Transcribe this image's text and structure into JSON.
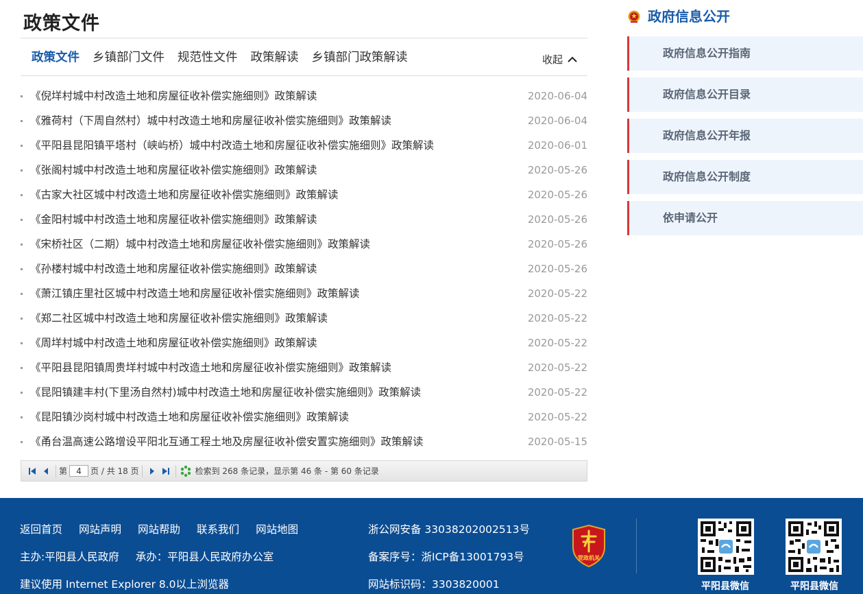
{
  "main": {
    "title": "政策文件",
    "tabs": [
      {
        "label": "政策文件",
        "active": true
      },
      {
        "label": "乡镇部门文件",
        "active": false
      },
      {
        "label": "规范性文件",
        "active": false
      },
      {
        "label": "政策解读",
        "active": false
      },
      {
        "label": "乡镇部门政策解读",
        "active": false
      }
    ],
    "collapse_label": "收起",
    "items": [
      {
        "title": "《倪垟村城中村改造土地和房屋征收补偿实施细则》政策解读",
        "date": "2020-06-04"
      },
      {
        "title": "《雅荷村（下周自然村）城中村改造土地和房屋征收补偿实施细则》政策解读",
        "date": "2020-06-04"
      },
      {
        "title": "《平阳县昆阳镇平塔村（峡屿桥）城中村改造土地和房屋征收补偿实施细则》政策解读",
        "date": "2020-06-01"
      },
      {
        "title": "《张阁村城中村改造土地和房屋征收补偿实施细则》政策解读",
        "date": "2020-05-26"
      },
      {
        "title": "《古家大社区城中村改造土地和房屋征收补偿实施细则》政策解读",
        "date": "2020-05-26"
      },
      {
        "title": "《金阳村城中村改造土地和房屋征收补偿实施细则》政策解读",
        "date": "2020-05-26"
      },
      {
        "title": "《宋桥社区（二期）城中村改造土地和房屋征收补偿实施细则》政策解读",
        "date": "2020-05-26"
      },
      {
        "title": "《孙楼村城中村改造土地和房屋征收补偿实施细则》政策解读",
        "date": "2020-05-26"
      },
      {
        "title": "《萧江镇庄里社区城中村改造土地和房屋征收补偿实施细则》政策解读",
        "date": "2020-05-22"
      },
      {
        "title": "《郑二社区城中村改造土地和房屋征收补偿实施细则》政策解读",
        "date": "2020-05-22"
      },
      {
        "title": "《周垟村城中村改造土地和房屋征收补偿实施细则》政策解读",
        "date": "2020-05-22"
      },
      {
        "title": "《平阳县昆阳镇周贵垟村城中村改造土地和房屋征收补偿实施细则》政策解读",
        "date": "2020-05-22"
      },
      {
        "title": "《昆阳镇建丰村(下里汤自然村)城中村改造土地和房屋征收补偿实施细则》政策解读",
        "date": "2020-05-22"
      },
      {
        "title": "《昆阳镇沙岗村城中村改造土地和房屋征收补偿实施细则》政策解读",
        "date": "2020-05-22"
      },
      {
        "title": "《甬台温高速公路增设平阳北互通工程土地及房屋征收补偿安置实施细则》政策解读",
        "date": "2020-05-15"
      }
    ],
    "pager": {
      "page_prefix": "第",
      "page_value": "4",
      "page_suffix": "页 / 共 18 页",
      "summary": "检索到 268 条记录，显示第 46 条 - 第 60 条记录"
    }
  },
  "sidebar": {
    "title": "政府信息公开",
    "items": [
      {
        "label": "政府信息公开指南"
      },
      {
        "label": "政府信息公开目录"
      },
      {
        "label": "政府信息公开年报"
      },
      {
        "label": "政府信息公开制度"
      },
      {
        "label": "依申请公开"
      }
    ]
  },
  "footer": {
    "links": [
      "返回首页",
      "网站声明",
      "网站帮助",
      "联系我们",
      "网站地图"
    ],
    "host": "主办:平阳县人民政府",
    "organizer": "承办：平阳县人民政府办公室",
    "browser_note": "建议使用 Internet Explorer 8.0以上浏览器",
    "police_record": "浙公网安备 33038202002513号",
    "icp_record": "备案序号：浙ICP备13001793号",
    "site_code": "网站标识码：3303820001",
    "emblem_text": "党政机关",
    "qr_labels": [
      "平阳县微信",
      "平阳县微信"
    ]
  },
  "colors": {
    "accent_blue": "#1a5caa",
    "footer_blue": "#0b4d93",
    "sidebar_bg": "#eef4fb",
    "sidebar_border": "#d6383a",
    "date_gray": "#999999"
  },
  "icons": {
    "collapse": "chevron-up-icon",
    "sidebar_head": "national-emblem-icon",
    "pager_first": "first-page-icon",
    "pager_prev": "prev-page-icon",
    "pager_next": "next-page-icon",
    "pager_last": "last-page-icon",
    "pager_refresh": "refresh-icon",
    "footer_emblem": "party-government-emblem-icon"
  }
}
